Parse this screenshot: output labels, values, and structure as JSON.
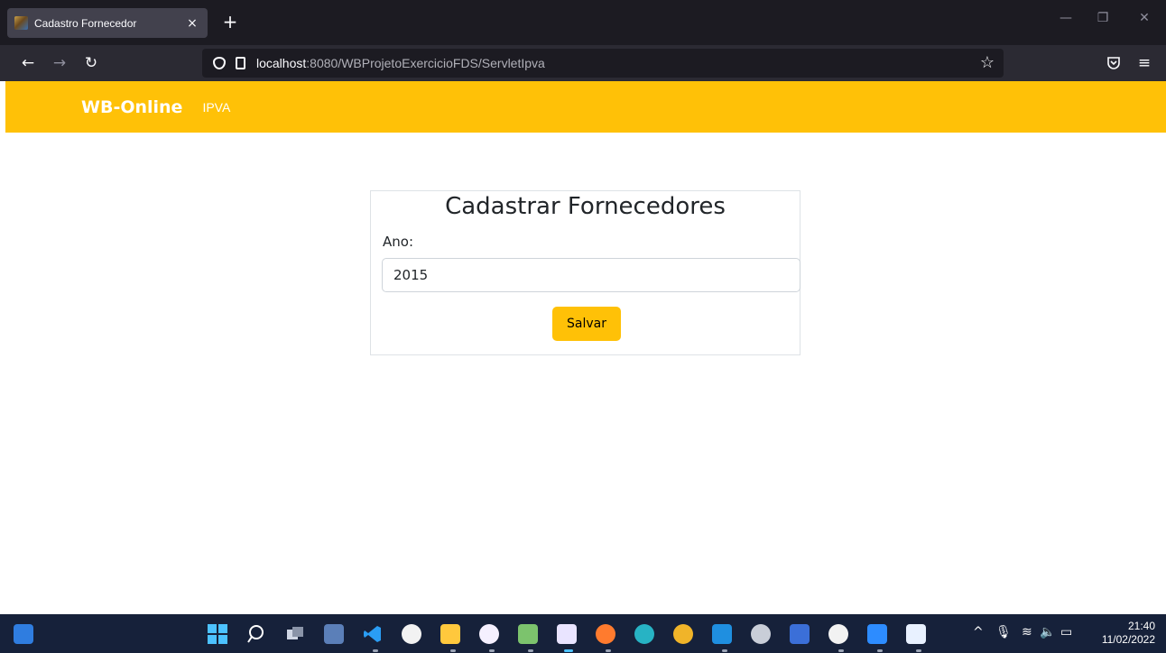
{
  "browser": {
    "tab_title": "Cadastro Fornecedor",
    "tab_close": "×",
    "new_tab": "+",
    "url_host": "localhost",
    "url_path": ":8080/WBProjetoExercicioFDS/ServletIpva"
  },
  "site": {
    "brand": "WB-Online",
    "nav_link": "IPVA"
  },
  "form": {
    "title": "Cadastrar Fornecedores",
    "label": "Ano:",
    "value": "2015",
    "button": "Salvar"
  },
  "taskbar": {
    "time": "21:40",
    "date": "11/02/2022",
    "icons": [
      "widgets-icon",
      "start-icon",
      "search-icon",
      "task-view-icon",
      "vs-icon",
      "vscode-icon",
      "github-icon",
      "file-explorer-icon",
      "eclipse-icon",
      "notepad-icon",
      "snipping-tool-icon",
      "firefox-icon",
      "edge-icon",
      "chrome-icon",
      "mail-icon",
      "settings-icon",
      "store-icon",
      "github-desktop-icon",
      "zoom-icon",
      "libreoffice-icon"
    ]
  }
}
